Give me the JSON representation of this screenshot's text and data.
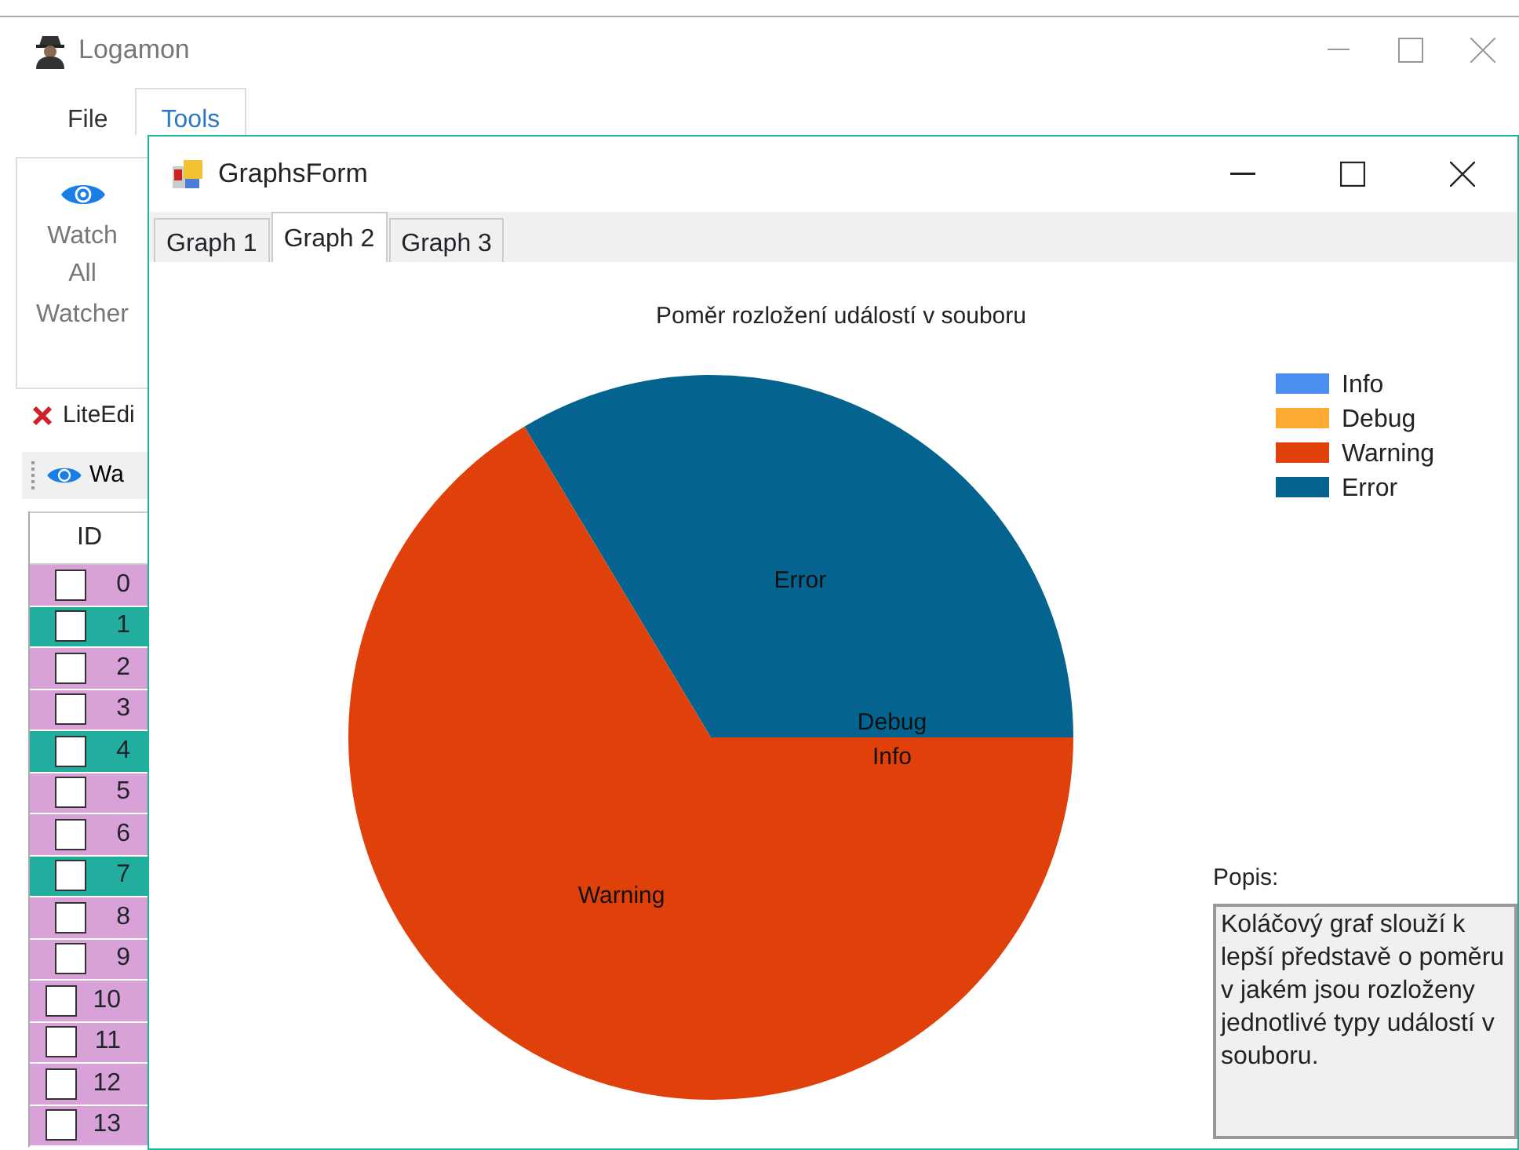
{
  "main_window": {
    "title": "Logamon",
    "menu_tabs": [
      {
        "label": "File",
        "selected": false
      },
      {
        "label": "Tools",
        "selected": true
      }
    ],
    "ribbon": {
      "button": "Watch All",
      "group_label": "Watcher"
    },
    "document_tab": {
      "label": "LiteEdi"
    },
    "toolbar": {
      "button": "Wa"
    },
    "table": {
      "columns": [
        "ID"
      ],
      "rows": [
        {
          "number": "0",
          "checked": false,
          "color": "#d8a2d8"
        },
        {
          "number": "1",
          "checked": false,
          "color": "#22ae9e"
        },
        {
          "number": "2",
          "checked": false,
          "color": "#d8a2d8"
        },
        {
          "number": "3",
          "checked": false,
          "color": "#d8a2d8"
        },
        {
          "number": "4",
          "checked": false,
          "color": "#22ae9e"
        },
        {
          "number": "5",
          "checked": false,
          "color": "#d8a2d8"
        },
        {
          "number": "6",
          "checked": false,
          "color": "#d8a2d8"
        },
        {
          "number": "7",
          "checked": false,
          "color": "#22ae9e"
        },
        {
          "number": "8",
          "checked": false,
          "color": "#d8a2d8"
        },
        {
          "number": "9",
          "checked": false,
          "color": "#d8a2d8"
        },
        {
          "number": "10",
          "checked": false,
          "color": "#d8a2d8"
        },
        {
          "number": "11",
          "checked": false,
          "color": "#d8a2d8"
        },
        {
          "number": "12",
          "checked": false,
          "color": "#d8a2d8"
        },
        {
          "number": "13",
          "checked": false,
          "color": "#d8a2d8"
        }
      ]
    }
  },
  "graphs_window": {
    "title": "GraphsForm",
    "tabs": [
      {
        "label": "Graph 1",
        "selected": false
      },
      {
        "label": "Graph 2",
        "selected": true
      },
      {
        "label": "Graph 3",
        "selected": false
      }
    ],
    "chart_data": {
      "type": "pie",
      "title": "Poměr rozložení událostí v souboru",
      "categories": [
        "Info",
        "Debug",
        "Warning",
        "Error"
      ],
      "series": [
        {
          "colors": [
            "#4a8ef0",
            "#ffaa33",
            "#e0400a",
            "#05638f"
          ],
          "values": [
            0,
            0,
            66.4,
            33.6
          ]
        }
      ],
      "annotations": [
        {
          "text": "Info",
          "x": "Info"
        },
        {
          "text": "Debug",
          "x": "Debug"
        },
        {
          "text": "Warning",
          "x": "Warning"
        },
        {
          "text": "Error",
          "x": "Error"
        }
      ],
      "legend": "right"
    },
    "description": {
      "label": "Popis:",
      "text": "Koláčový graf slouží k lepší představě o poměru v jakém jsou rozloženy jednotlivé typy událostí v souboru."
    }
  }
}
